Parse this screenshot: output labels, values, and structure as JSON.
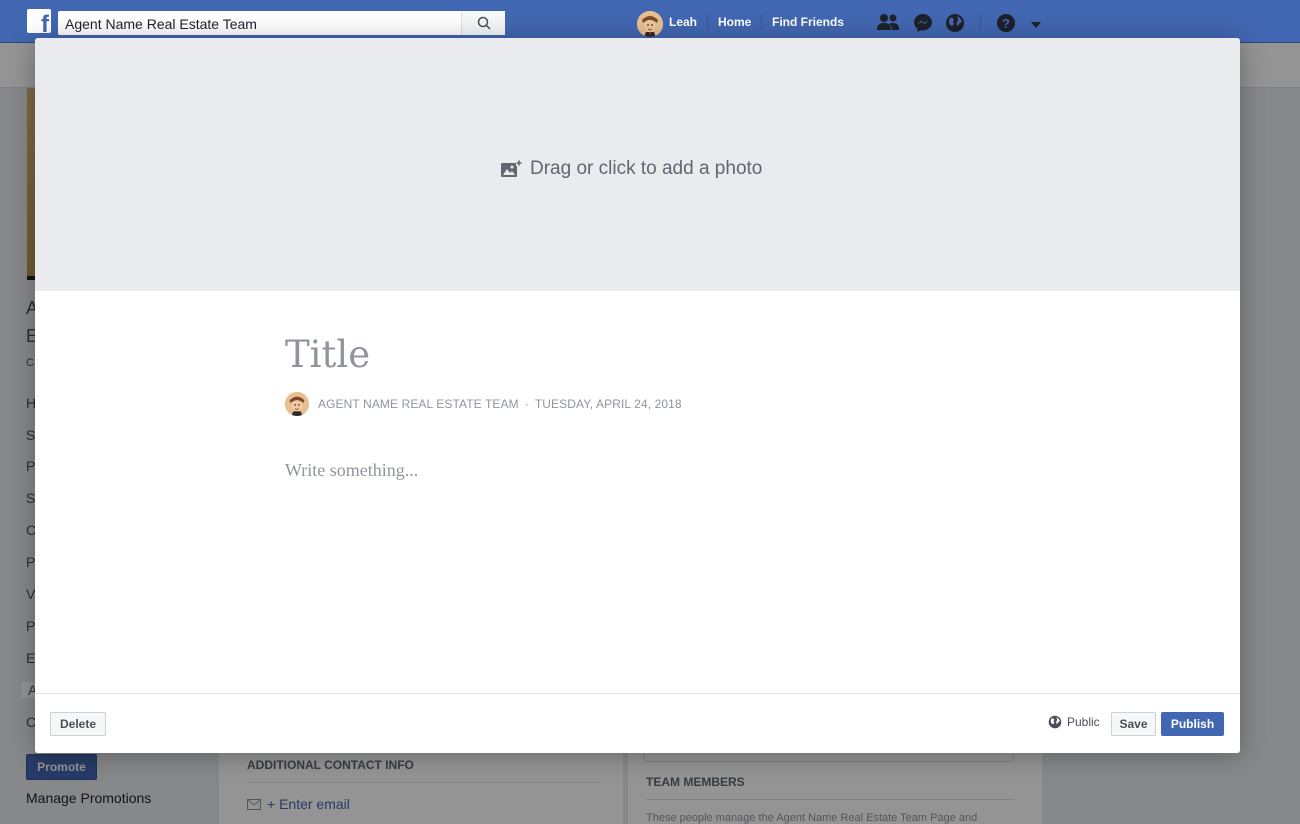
{
  "topbar": {
    "search_value": "Agent Name Real Estate Team",
    "user_name": "Leah",
    "home_label": "Home",
    "find_friends_label": "Find Friends",
    "icons": [
      "friend-requests-icon",
      "messenger-icon",
      "notifications-globe-icon",
      "help-icon",
      "account-dropdown-icon"
    ]
  },
  "background_page": {
    "promote_label": "Promote",
    "manage_promotions_label": "Manage Promotions",
    "additional_contact_title": "ADDITIONAL CONTACT INFO",
    "enter_email_label": "+ Enter email",
    "team_members_title": "TEAM MEMBERS",
    "team_members_text": "These people manage the Agent Name Real Estate Team Page and",
    "left_nav_letters": [
      "A",
      "E",
      "C",
      "H",
      "S",
      "P",
      "S",
      "C",
      "P",
      "V",
      "P",
      "E",
      "A",
      "C"
    ]
  },
  "editor": {
    "photo_prompt": "Drag or click to add a photo",
    "title_placeholder": "Title",
    "author": "AGENT NAME REAL ESTATE TEAM",
    "separator": "·",
    "date": "TUESDAY, APRIL 24, 2018",
    "body_placeholder": "Write something..."
  },
  "footer": {
    "delete_label": "Delete",
    "privacy_label": "Public",
    "save_label": "Save",
    "publish_label": "Publish"
  },
  "colors": {
    "brand_blue": "#4267b2",
    "photo_area_bg": "#e9ebee",
    "placeholder_gray": "#90949c"
  }
}
